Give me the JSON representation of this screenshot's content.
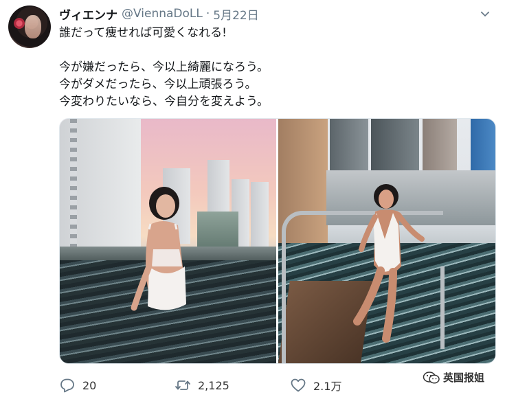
{
  "tweet": {
    "author": {
      "display_name": "ヴィエンナ",
      "handle": "@ViennaDoLL",
      "separator": "·",
      "date": "5月22日"
    },
    "lines": [
      "誰だって痩せれば可愛くなれる!",
      "",
      "今が嫌だったら、今以上綺麗になろう。",
      "今がダメだったら、今以上頑張ろう。",
      "今変わりたいなら、今自分を変えよう。"
    ],
    "actions": {
      "replies": "20",
      "retweets": "2,125",
      "likes": "2.1万"
    }
  },
  "watermark": {
    "text": "英国报姐"
  },
  "icons": {
    "menu": "chevron-down-icon",
    "reply": "reply-icon",
    "retweet": "retweet-icon",
    "like": "heart-icon",
    "watermark": "wechat-icon"
  },
  "colors": {
    "text": "#14171a",
    "secondary": "#657786",
    "icon": "#657786"
  }
}
